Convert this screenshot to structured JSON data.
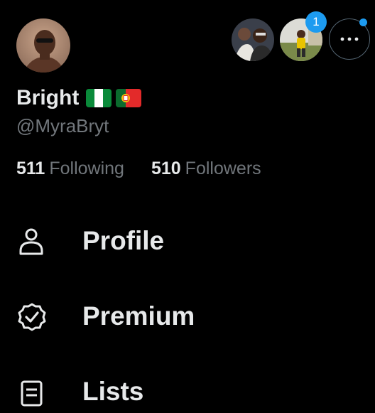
{
  "profile": {
    "name": "Bright",
    "handle": "@MyraBryt"
  },
  "flags": [
    "nigeria-flag-icon",
    "portugal-flag-icon"
  ],
  "stats": {
    "following_count": "511",
    "following_label": "Following",
    "followers_count": "510",
    "followers_label": "Followers"
  },
  "accounts": {
    "notification_count": "1"
  },
  "nav": {
    "items": [
      {
        "label": "Profile",
        "icon": "person-icon"
      },
      {
        "label": "Premium",
        "icon": "verified-badge-icon"
      },
      {
        "label": "Lists",
        "icon": "list-icon"
      }
    ]
  },
  "colors": {
    "background": "#000000",
    "text_primary": "#e7e9ea",
    "text_secondary": "#71767b",
    "accent": "#1d9bf0"
  }
}
